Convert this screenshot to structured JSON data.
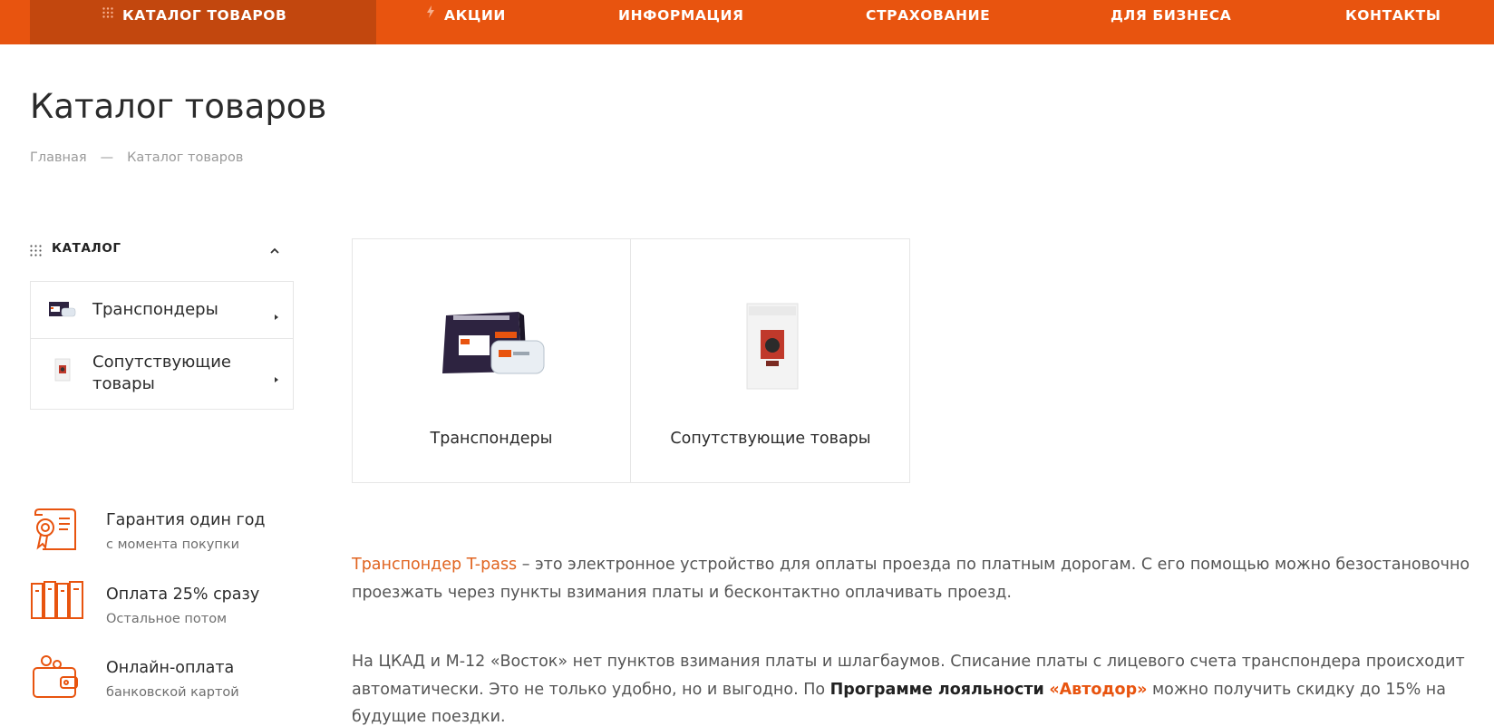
{
  "nav": {
    "items": [
      {
        "label": "КАТАЛОГ ТОВАРОВ",
        "icon": "grid-icon"
      },
      {
        "label": "АКЦИИ",
        "icon": "lightning-icon"
      },
      {
        "label": "ИНФОРМАЦИЯ"
      },
      {
        "label": "СТРАХОВАНИЕ"
      },
      {
        "label": "ДЛЯ БИЗНЕСА"
      },
      {
        "label": "КОНТАКТЫ"
      }
    ]
  },
  "page": {
    "title": "Каталог товаров",
    "breadcrumb": {
      "home": "Главная",
      "separator": "—",
      "current": "Каталог товаров"
    }
  },
  "sidebar": {
    "heading": "КАТАЛОГ",
    "items": [
      {
        "label": "Транспондеры"
      },
      {
        "label_line1": "Сопутствующие",
        "label_line2": "товары"
      }
    ]
  },
  "products": [
    {
      "title": "Транспондеры",
      "image": "transponder-box-image"
    },
    {
      "title": "Сопутствующие товары",
      "image": "accessory-pouch-image"
    }
  ],
  "benefits": [
    {
      "title": "Гарантия один год",
      "subtitle": "с момента покупки",
      "icon": "certificate-icon"
    },
    {
      "title": "Оплата 25% сразу",
      "subtitle": "Остальное потом",
      "icon": "books-icon"
    },
    {
      "title": "Онлайн-оплата",
      "subtitle": "банковской картой",
      "icon": "wallet-icon"
    }
  ],
  "description": {
    "p1_link": "Транспондер T-pass",
    "p1_text": " – это электронное устройство для оплаты проезда по платным дорогам. С его помощью можно безостановочно проезжать через пункты взимания платы и бесконтактно оплачивать проезд.",
    "p2_text_a": "На ЦКАД и М-12 «Восток» нет пунктов взимания платы и шлагбаумов. Списание платы с лицевого счета транспондера происходит автоматически. Это не только удобно, но и выгодно. По ",
    "p2_bold": "Программе лояльности",
    "p2_bold_link": "«Автодор»",
    "p2_text_b": " можно получить скидку до 15% на будущие поездки."
  },
  "colors": {
    "accent": "#e8540f",
    "nav_active": "#c2470e",
    "link": "#e06420"
  }
}
